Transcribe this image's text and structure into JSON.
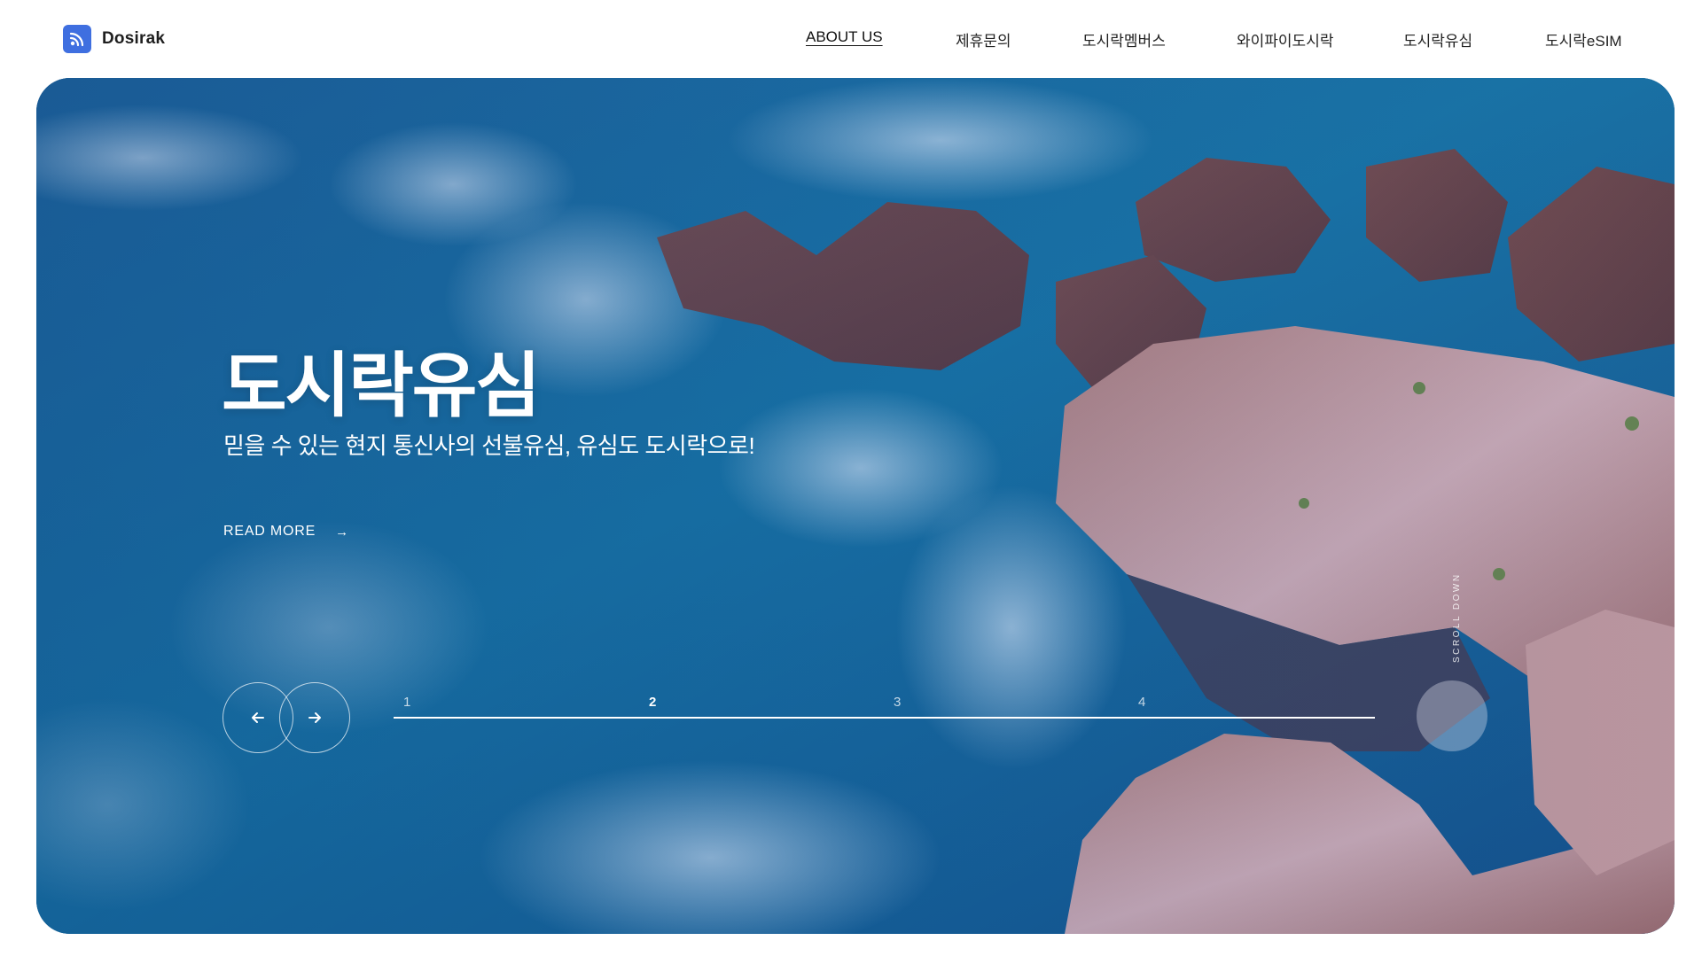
{
  "brand": {
    "name": "Dosirak",
    "logo_icon": "rss-icon",
    "accent": "#3f6fe0"
  },
  "nav": {
    "items": [
      {
        "label": "ABOUT US",
        "active": true
      },
      {
        "label": "제휴문의"
      },
      {
        "label": "도시락멤버스"
      },
      {
        "label": "와이파이도시락"
      },
      {
        "label": "도시락유심"
      },
      {
        "label": "도시락eSIM"
      }
    ]
  },
  "hero": {
    "title": "도시락유심",
    "subtitle": "믿을 수 있는 현지 통신사의 선불유심, 유심도 도시락으로!",
    "read_more": "READ MORE",
    "read_more_icon": "arrow-right-icon",
    "prev_icon": "arrow-left-icon",
    "next_icon": "arrow-right-icon",
    "steps": [
      "1",
      "2",
      "3",
      "4"
    ],
    "active_step": 2,
    "scroll_label": "SCROLL DOWN"
  }
}
